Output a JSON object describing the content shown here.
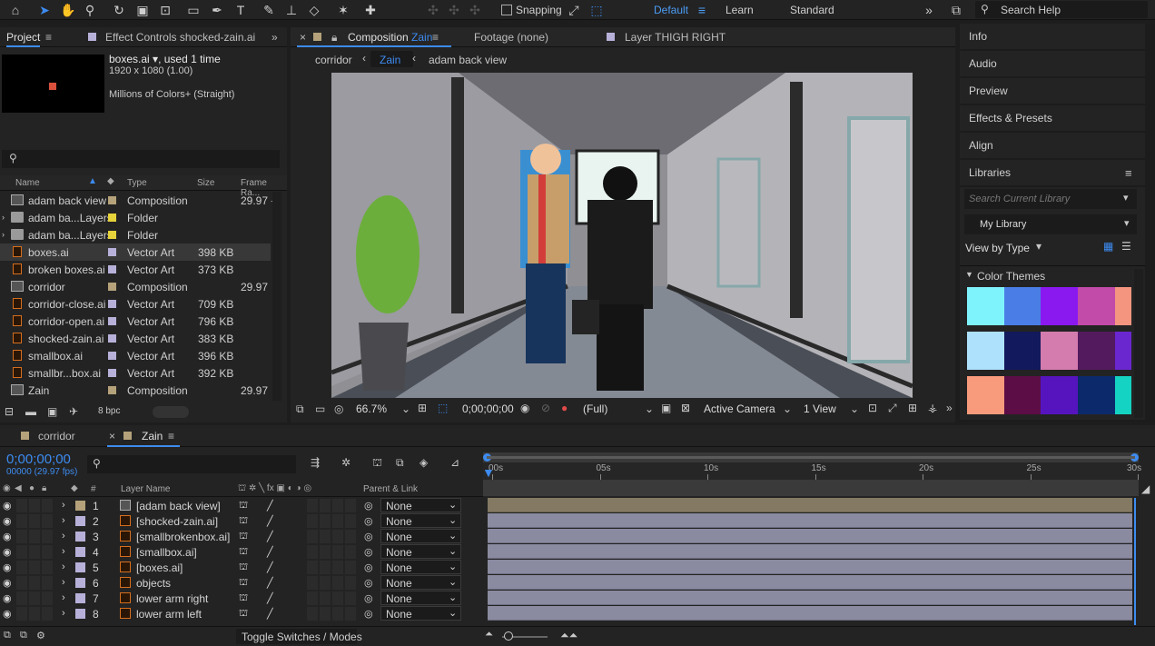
{
  "toolbar": {
    "snapping": "Snapping",
    "workspaces": [
      "Default",
      "Learn",
      "Standard"
    ],
    "search_help": "Search Help"
  },
  "project_panel": {
    "tab_project": "Project",
    "tab_effect_controls": "Effect Controls shocked-zain.ai",
    "selected_name": "boxes.ai",
    "selected_used": ", used 1 time",
    "selected_size": "1920 x 1080 (1.00)",
    "selected_colors": "Millions of Colors+ (Straight)",
    "columns": {
      "name": "Name",
      "type": "Type",
      "size": "Size",
      "frame_rate": "Frame Ra..."
    },
    "items": [
      {
        "name": "adam back view",
        "type": "Composition",
        "size": "",
        "fps": "29.97",
        "kind": "comp",
        "label": "#b5a27a"
      },
      {
        "name": "adam ba...Layers",
        "type": "Folder",
        "size": "",
        "fps": "",
        "kind": "folder",
        "label": "#e6d23a"
      },
      {
        "name": "adam ba...Layers",
        "type": "Folder",
        "size": "",
        "fps": "",
        "kind": "folder",
        "label": "#e6d23a"
      },
      {
        "name": "boxes.ai",
        "type": "Vector Art",
        "size": "398 KB",
        "fps": "",
        "kind": "ai",
        "label": "#b7b1d9"
      },
      {
        "name": "broken boxes.ai",
        "type": "Vector Art",
        "size": "373 KB",
        "fps": "",
        "kind": "ai",
        "label": "#b7b1d9"
      },
      {
        "name": "corridor",
        "type": "Composition",
        "size": "",
        "fps": "29.97",
        "kind": "comp",
        "label": "#b5a27a"
      },
      {
        "name": "corridor-close.ai",
        "type": "Vector Art",
        "size": "709 KB",
        "fps": "",
        "kind": "ai",
        "label": "#b7b1d9"
      },
      {
        "name": "corridor-open.ai",
        "type": "Vector Art",
        "size": "796 KB",
        "fps": "",
        "kind": "ai",
        "label": "#b7b1d9"
      },
      {
        "name": "shocked-zain.ai",
        "type": "Vector Art",
        "size": "383 KB",
        "fps": "",
        "kind": "ai",
        "label": "#b7b1d9"
      },
      {
        "name": "smallbox.ai",
        "type": "Vector Art",
        "size": "396 KB",
        "fps": "",
        "kind": "ai",
        "label": "#b7b1d9"
      },
      {
        "name": "smallbr...box.ai",
        "type": "Vector Art",
        "size": "392 KB",
        "fps": "",
        "kind": "ai",
        "label": "#b7b1d9"
      },
      {
        "name": "Zain",
        "type": "Composition",
        "size": "",
        "fps": "29.97",
        "kind": "comp",
        "label": "#b5a27a"
      }
    ],
    "bpc": "8 bpc"
  },
  "composition_panel": {
    "tab_composition": "Composition",
    "tab_comp_name": "Zain",
    "tab_footage": "Footage (none)",
    "tab_layer": "Layer THIGH RIGHT",
    "breadcrumb": [
      "corridor",
      "Zain",
      "adam back view"
    ],
    "zoom": "66.7%",
    "timecode": "0;00;00;00",
    "resolution": "(Full)",
    "camera": "Active Camera",
    "views": "1 View"
  },
  "right_panels": {
    "items": [
      "Info",
      "Audio",
      "Preview",
      "Effects & Presets",
      "Align",
      "Libraries"
    ],
    "search_library_placeholder": "Search Current Library",
    "library_select": "My Library",
    "view_by_type": "View by Type",
    "color_themes": "Color Themes",
    "themes": [
      [
        "#7ff3fb",
        "#4a7ee6",
        "#8a19f0",
        "#c24aa8",
        "#f3957f"
      ],
      [
        "#aee1fb",
        "#12195c",
        "#d37cad",
        "#531a5e",
        "#6b27cf"
      ],
      [
        "#f89a7c",
        "#5c0d46",
        "#5614bf",
        "#0c2a6b",
        "#14d3c2"
      ]
    ]
  },
  "timeline": {
    "tabs": [
      "corridor",
      "Zain"
    ],
    "timecode": "0;00;00;00",
    "fps_line": "00000 (29.97 fps)",
    "col_layer_name": "Layer Name",
    "col_parent": "Parent & Link",
    "ruler": [
      "00s",
      "05s",
      "10s",
      "15s",
      "20s",
      "25s",
      "30s"
    ],
    "layers": [
      {
        "num": "1",
        "name": "[adam back view]",
        "kind": "comp",
        "parent": "None"
      },
      {
        "num": "2",
        "name": "[shocked-zain.ai]",
        "kind": "ai",
        "parent": "None"
      },
      {
        "num": "3",
        "name": "[smallbrokenbox.ai]",
        "kind": "ai",
        "parent": "None"
      },
      {
        "num": "4",
        "name": "[smallbox.ai]",
        "kind": "ai",
        "parent": "None"
      },
      {
        "num": "5",
        "name": "[boxes.ai]",
        "kind": "ai",
        "parent": "None"
      },
      {
        "num": "6",
        "name": "objects",
        "kind": "ai",
        "parent": "None"
      },
      {
        "num": "7",
        "name": "lower arm right",
        "kind": "ai",
        "parent": "None"
      },
      {
        "num": "8",
        "name": "lower arm left",
        "kind": "ai",
        "parent": "None"
      }
    ],
    "toggle": "Toggle Switches / Modes"
  }
}
